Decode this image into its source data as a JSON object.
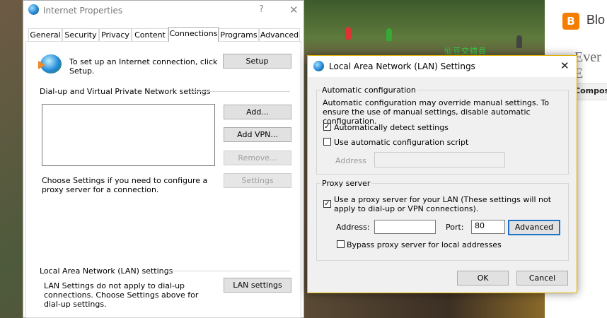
{
  "background": {
    "caption": "仙豆交錯員"
  },
  "blogger": {
    "logo_letter": "B",
    "name": "Blo",
    "subtitle": "Ever E",
    "compose": "Compose"
  },
  "internet_properties": {
    "title": "Internet Properties",
    "help_glyph": "?",
    "close_glyph": "✕",
    "tabs": [
      "General",
      "Security",
      "Privacy",
      "Content",
      "Connections",
      "Programs",
      "Advanced"
    ],
    "selected_tab": "Connections",
    "setup_text": "To set up an Internet connection, click Setup.",
    "setup_button": "Setup",
    "dialup_group": "Dial-up and Virtual Private Network settings",
    "add_button": "Add...",
    "add_vpn_button": "Add VPN...",
    "remove_button": "Remove...",
    "settings_button": "Settings",
    "proxy_text": "Choose Settings if you need to configure a proxy server for a connection.",
    "lan_group": "Local Area Network (LAN) settings",
    "lan_text": "LAN Settings do not apply to dial-up connections. Choose Settings above for dial-up settings.",
    "lan_button": "LAN settings"
  },
  "lan_dialog": {
    "title": "Local Area Network (LAN) Settings",
    "close_glyph": "✕",
    "auto_group": "Automatic configuration",
    "auto_desc": "Automatic configuration may override manual settings.  To ensure the use of manual settings, disable automatic configuration.",
    "auto_detect_label": "Automatically detect settings",
    "auto_detect_checked": true,
    "auto_script_label": "Use automatic configuration script",
    "auto_script_checked": false,
    "script_address_label": "Address",
    "script_address_value": "",
    "proxy_group": "Proxy server",
    "use_proxy_label": "Use a proxy server for your LAN (These settings will not apply to dial-up or VPN connections).",
    "use_proxy_checked": true,
    "address_label": "Address:",
    "address_value": "",
    "port_label": "Port:",
    "port_value": "80",
    "advanced_button": "Advanced",
    "bypass_label": "Bypass proxy server for local addresses",
    "bypass_checked": false,
    "ok_button": "OK",
    "cancel_button": "Cancel",
    "check_glyph": "✓"
  }
}
